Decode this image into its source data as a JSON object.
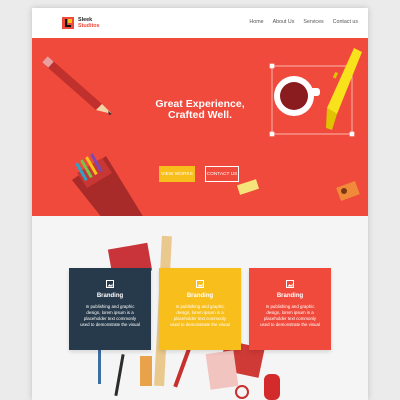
{
  "brand": {
    "line1": "Sleek",
    "line2": "Studitos"
  },
  "nav": {
    "items": [
      "Home",
      "About Us",
      "Services",
      "Contact us"
    ]
  },
  "hero": {
    "title_line1": "Great Experience,",
    "title_line2": "Crafted Well.",
    "primary_button": "VIEW WORKS",
    "secondary_button": "CONTACT US"
  },
  "cards": [
    {
      "title": "Branding",
      "text": "In publishing and graphic design, lorem ipsum is a placeholder text commonly used to demonstrate the visual",
      "color": "#273a4b",
      "icon": "image-icon"
    },
    {
      "title": "Branding",
      "text": "In publishing and graphic design, lorem ipsum is a placeholder text commonly used to demonstrate the visual",
      "color": "#f8be1c",
      "icon": "image-icon"
    },
    {
      "title": "Branding",
      "text": "In publishing and graphic design, lorem ipsum is a placeholder text commonly used to demonstrate the visual",
      "color": "#f04a3c",
      "icon": "image-icon"
    }
  ],
  "colors": {
    "accent": "#f04a3c",
    "yellow": "#f8be1c",
    "navy": "#273a4b"
  }
}
